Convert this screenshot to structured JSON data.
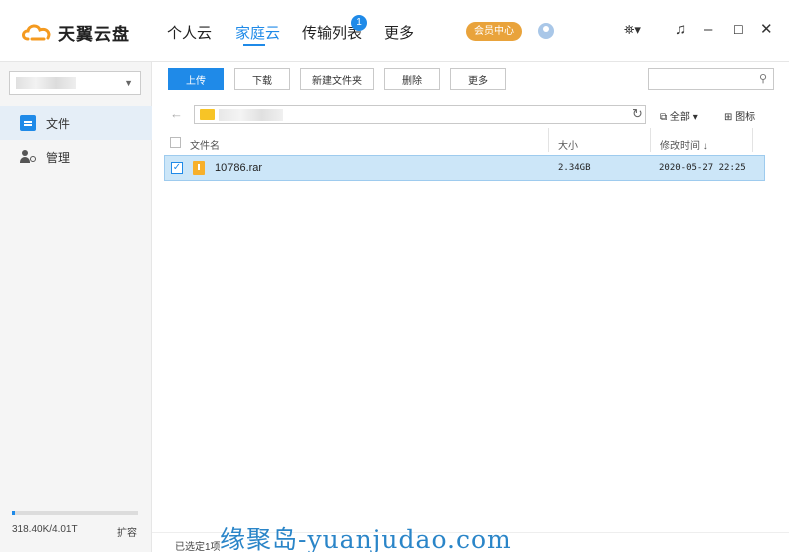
{
  "app": {
    "logo_text": "天翼云盘",
    "nav": [
      {
        "label": "个人云"
      },
      {
        "label": "家庭云"
      },
      {
        "label": "传输列表"
      },
      {
        "label": "更多"
      }
    ],
    "transfer_badge": "1",
    "vip_label": "会员中心",
    "window_controls": [
      "skin-icon",
      "bell-icon",
      "minimize-icon",
      "maximize-icon",
      "close-icon"
    ]
  },
  "sidebar": {
    "items": [
      {
        "label": "文件",
        "icon": "file-icon"
      },
      {
        "label": "管理",
        "icon": "member-icon"
      }
    ],
    "quota": {
      "text": "318.40K/4.01T",
      "used_fraction": 0.02
    },
    "expand_label": "扩容"
  },
  "toolbar": {
    "upload": "上传",
    "download": "下载",
    "new_folder": "新建文件夹",
    "delete": "删除",
    "more": "更多",
    "search_placeholder": ""
  },
  "view": {
    "all_label": "全部",
    "icon_view_label": "图标"
  },
  "table": {
    "columns": {
      "name": "文件名",
      "size": "大小",
      "modified": "修改时间"
    },
    "rows": [
      {
        "name": "10786.rar",
        "size": "2.34GB",
        "modified": "2020-05-27 22:25",
        "selected": true
      }
    ]
  },
  "status": {
    "selected_text": "已选定1项"
  },
  "watermark": "缘聚岛-yuanjudao.com",
  "colors": {
    "accent": "#1f8ae8",
    "vip": "#e9a33b",
    "selected_row": "#cce6f8"
  }
}
